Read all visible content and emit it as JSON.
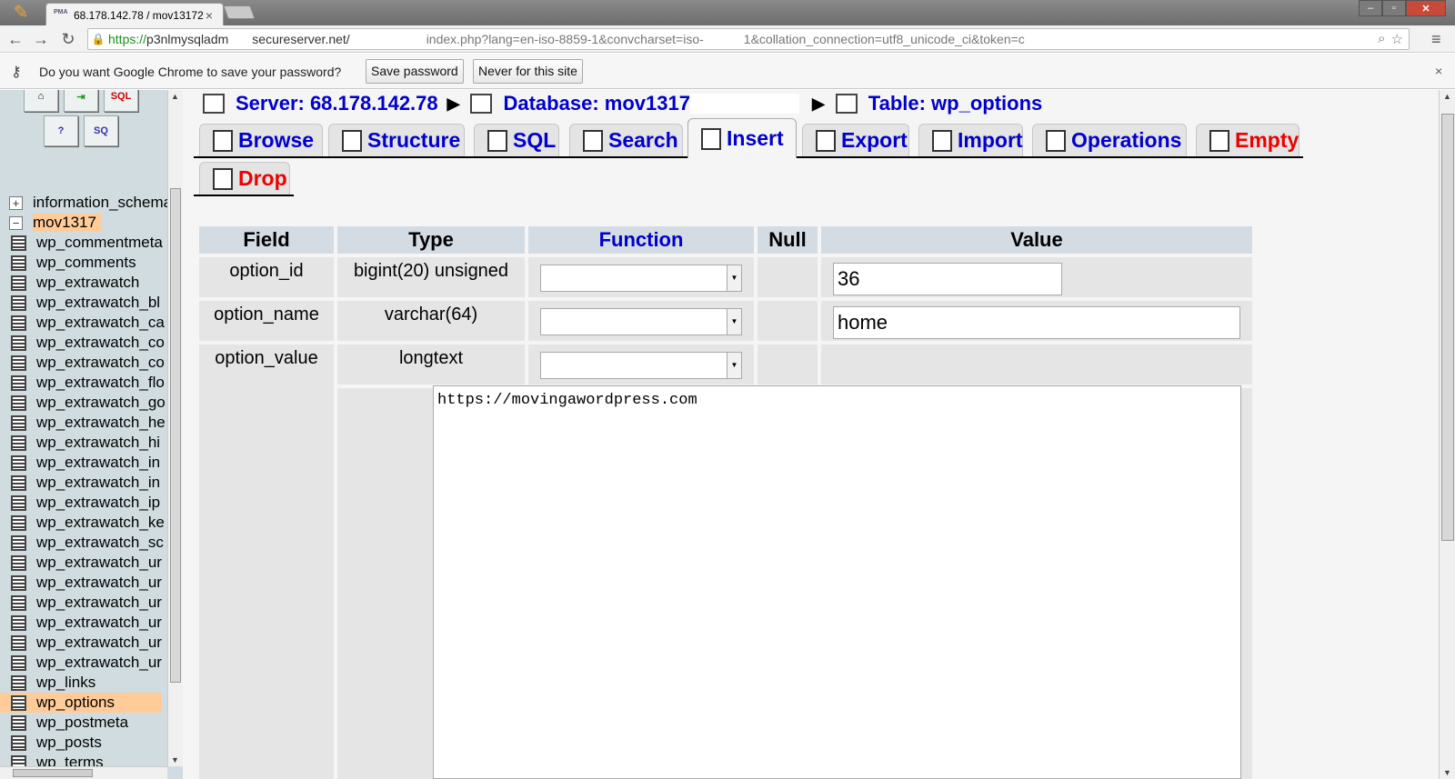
{
  "browser": {
    "tab_title": "68.178.142.78 / mov13172",
    "tab_favicon": "PMA",
    "url_scheme": "https://",
    "url_host_a": "p3nlmysqladm",
    "url_host_b": "secureserver.net/",
    "url_path_a": "index.php?lang=en-iso-8859-1&convcharset=iso-",
    "url_path_b": "1&collation_connection=utf8_unicode_ci&token=c"
  },
  "password_bar": {
    "message": "Do you want Google Chrome to save your password?",
    "save_label": "Save password",
    "never_label": "Never for this site"
  },
  "nav_tree": {
    "databases": [
      "information_schema",
      "mov1317"
    ],
    "current_db": "mov1317",
    "tables": [
      "wp_commentmeta",
      "wp_comments",
      "wp_extrawatch",
      "wp_extrawatch_bl",
      "wp_extrawatch_ca",
      "wp_extrawatch_co",
      "wp_extrawatch_co",
      "wp_extrawatch_flo",
      "wp_extrawatch_go",
      "wp_extrawatch_he",
      "wp_extrawatch_hi",
      "wp_extrawatch_in",
      "wp_extrawatch_in",
      "wp_extrawatch_ip",
      "wp_extrawatch_ke",
      "wp_extrawatch_sc",
      "wp_extrawatch_ur",
      "wp_extrawatch_ur",
      "wp_extrawatch_ur",
      "wp_extrawatch_ur",
      "wp_extrawatch_ur",
      "wp_extrawatch_ur",
      "wp_links",
      "wp_options",
      "wp_postmeta",
      "wp_posts",
      "wp_terms"
    ],
    "current_table": "wp_options"
  },
  "breadcrumb": {
    "server": "Server: 68.178.142.78",
    "database": "Database: mov1317",
    "table": "Table: wp_options"
  },
  "tabs": {
    "browse": "Browse",
    "structure": "Structure",
    "sql": "SQL",
    "search": "Search",
    "insert": "Insert",
    "export": "Export",
    "import": "Import",
    "operations": "Operations",
    "empty": "Empty",
    "drop": "Drop",
    "active": "Insert"
  },
  "insert_form": {
    "headers": {
      "field": "Field",
      "type": "Type",
      "function": "Function",
      "null": "Null",
      "value": "Value"
    },
    "rows": [
      {
        "field": "option_id",
        "type": "bigint(20) unsigned",
        "value": "36"
      },
      {
        "field": "option_name",
        "type": "varchar(64)",
        "value": "home"
      },
      {
        "field": "option_value",
        "type": "longtext",
        "value": "https://movingawordpress.com"
      }
    ]
  },
  "colors": {
    "link_blue": "#0000cc",
    "danger_red": "#ee0000",
    "highlight": "#ffcc99",
    "nav_bg": "#d0dce0",
    "header_bg": "#d3dce3"
  }
}
